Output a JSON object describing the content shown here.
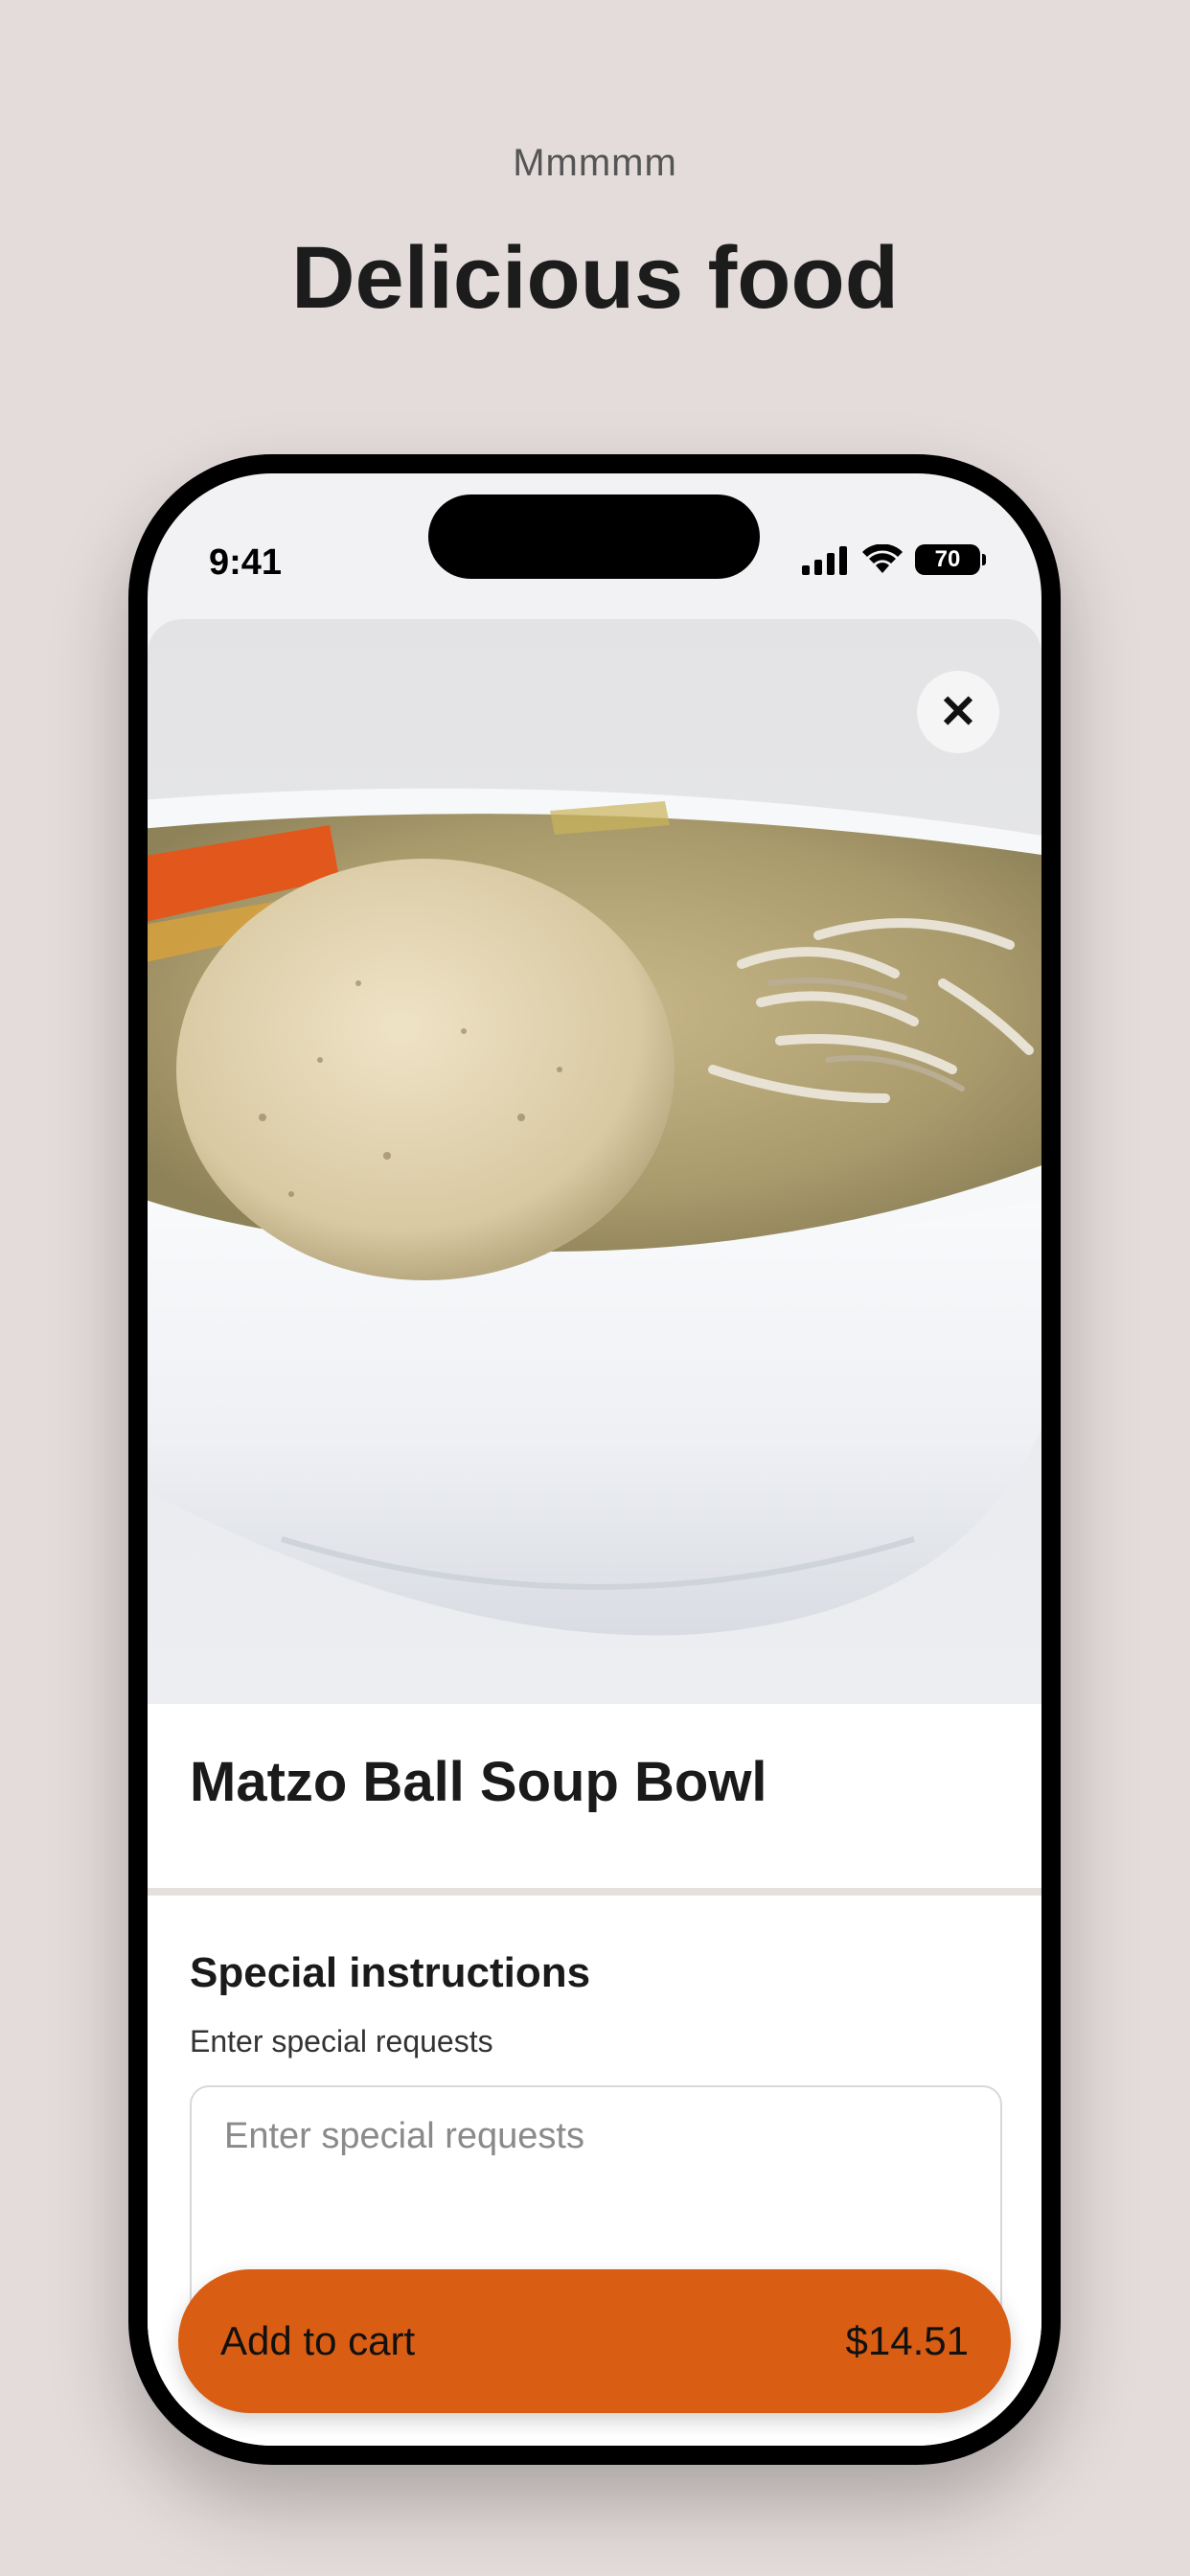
{
  "hero": {
    "eyebrow": "Mmmmm",
    "headline": "Delicious food"
  },
  "status_bar": {
    "time": "9:41",
    "battery": "70",
    "icons": [
      "cellular-signal-icon",
      "wifi-icon",
      "battery-icon"
    ]
  },
  "item": {
    "title": "Matzo Ball Soup Bowl",
    "image_icon": "food-photo"
  },
  "instructions": {
    "title": "Special instructions",
    "subtitle": "Enter special requests",
    "placeholder": "Enter special requests",
    "value": ""
  },
  "cart": {
    "label": "Add to cart",
    "price": "$14.51"
  },
  "colors": {
    "background": "#e4dcdb",
    "accent": "#d95d13"
  }
}
